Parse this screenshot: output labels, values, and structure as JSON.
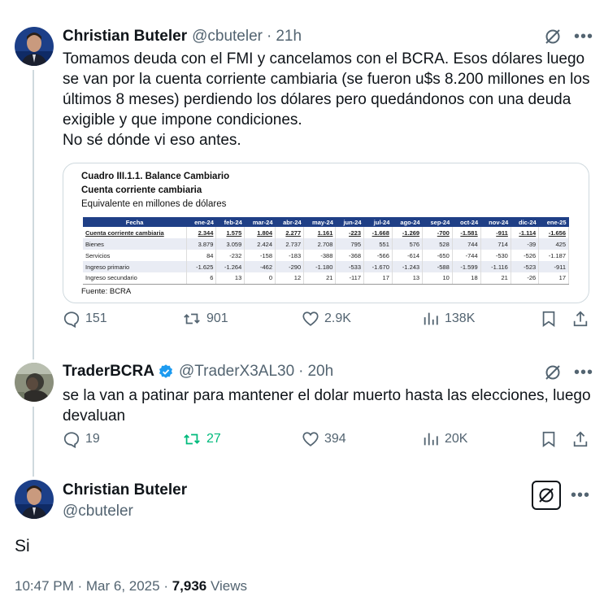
{
  "tweets": [
    {
      "name": "Christian Buteler",
      "handle": "@cbuteler",
      "time": "21h",
      "text": "Tomamos deuda con el FMI y cancelamos con el BCRA. Esos dólares luego se van por la cuenta corriente cambiaria (se fueron u$s 8.200 millones en los últimos 8 meses) perdiendo los dólares pero quedándonos con una deuda exigible y que impone condiciones.\nNo sé dónde vi eso antes.",
      "media": {
        "title1": "Cuadro III.1.1. Balance Cambiario",
        "title2": "Cuenta corriente cambiaria",
        "title3": "Equivalente en millones de dólares",
        "source": "Fuente: BCRA",
        "columns": [
          "Fecha",
          "ene-24",
          "feb-24",
          "mar-24",
          "abr-24",
          "may-24",
          "jun-24",
          "jul-24",
          "ago-24",
          "sep-24",
          "oct-24",
          "nov-24",
          "dic-24",
          "ene-25"
        ],
        "rows": [
          [
            "Cuenta corriente cambiaria",
            "2.344",
            "1.575",
            "1.804",
            "2.277",
            "1.161",
            "-223",
            "-1.668",
            "-1.269",
            "-700",
            "-1.581",
            "-911",
            "-1.114",
            "-1.656"
          ],
          [
            "Bienes",
            "3.879",
            "3.059",
            "2.424",
            "2.737",
            "2.708",
            "795",
            "551",
            "576",
            "528",
            "744",
            "714",
            "-39",
            "425"
          ],
          [
            "Servicios",
            "84",
            "-232",
            "-158",
            "-183",
            "-388",
            "-368",
            "-566",
            "-614",
            "-650",
            "-744",
            "-530",
            "-526",
            "-1.187"
          ],
          [
            "Ingreso primario",
            "-1.625",
            "-1.264",
            "-462",
            "-290",
            "-1.180",
            "-533",
            "-1.670",
            "-1.243",
            "-588",
            "-1.599",
            "-1.116",
            "-523",
            "-911"
          ],
          [
            "Ingreso secundario",
            "6",
            "13",
            "0",
            "12",
            "21",
            "-117",
            "17",
            "13",
            "10",
            "18",
            "21",
            "-26",
            "17"
          ]
        ]
      },
      "stats": {
        "replies": "151",
        "retweets": "901",
        "likes": "2.9K",
        "views": "138K"
      }
    },
    {
      "name": "TraderBCRA",
      "handle": "@TraderX3AL30",
      "time": "20h",
      "text": "se la van a patinar para mantener el dolar muerto hasta las elecciones, luego devaluan",
      "stats": {
        "replies": "19",
        "retweets": "27",
        "likes": "394",
        "views": "20K"
      }
    },
    {
      "name": "Christian Buteler",
      "handle": "@cbuteler",
      "text": "Si",
      "timestamp": "10:47 PM · Mar 6, 2025",
      "views_count": "7,936",
      "views_label": "Views"
    }
  ],
  "icons": [
    "grok-icon",
    "more-icon",
    "reply-icon",
    "retweet-icon",
    "like-icon",
    "views-icon",
    "bookmark-icon",
    "share-icon",
    "verified-icon"
  ],
  "colors": {
    "accent": "#1d9bf0",
    "muted": "#536471",
    "retweet_active": "#00ba7c",
    "table_header": "#1f3f86"
  }
}
